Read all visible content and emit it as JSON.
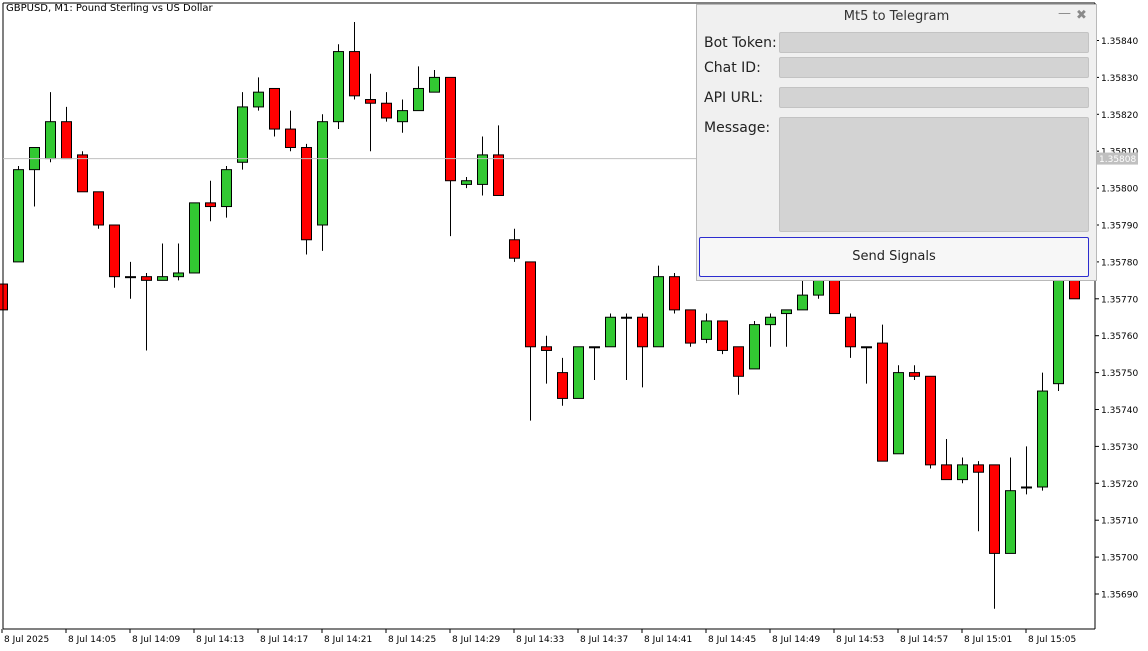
{
  "chart_header": {
    "symbol_text": "GBPUSD, M1:  Pound Sterling vs US Dollar"
  },
  "panel": {
    "title": "Mt5 to Telegram",
    "minimize_glyph": "—",
    "close_glyph": "✖",
    "bot_token_label": "Bot Token:",
    "chat_id_label": "Chat ID:",
    "api_url_label": "API URL:",
    "message_label": "Message:",
    "bot_token_value": "",
    "chat_id_value": "",
    "api_url_value": "",
    "message_value": "",
    "send_label": "Send Signals"
  },
  "colors": {
    "bull": "#32c832",
    "bear": "#ff0000",
    "panel_bg": "#f0f0f0",
    "field_bg": "#d3d3d3",
    "button_border": "#2c2ccf"
  },
  "chart_data": {
    "type": "candlestick",
    "symbol": "GBPUSD",
    "timeframe": "M1",
    "current_price": "1.35808",
    "y_ticks": [
      "1.35840",
      "1.35830",
      "1.35820",
      "1.35810",
      "1.35800",
      "1.35790",
      "1.35780",
      "1.35770",
      "1.35760",
      "1.35750",
      "1.35740",
      "1.35730",
      "1.35720",
      "1.35710",
      "1.35700",
      "1.35690"
    ],
    "x_ticks": [
      "8 Jul 2025",
      "8 Jul 14:05",
      "8 Jul 14:09",
      "8 Jul 14:13",
      "8 Jul 14:17",
      "8 Jul 14:21",
      "8 Jul 14:25",
      "8 Jul 14:29",
      "8 Jul 14:33",
      "8 Jul 14:37",
      "8 Jul 14:41",
      "8 Jul 14:45",
      "8 Jul 14:49",
      "8 Jul 14:53",
      "8 Jul 14:57",
      "8 Jul 15:01",
      "8 Jul 15:05"
    ],
    "candles": [
      {
        "o": 1.35774,
        "h": 1.35774,
        "l": 1.35767,
        "c": 1.35767
      },
      {
        "o": 1.3578,
        "h": 1.35806,
        "l": 1.3578,
        "c": 1.35805
      },
      {
        "o": 1.35805,
        "h": 1.35811,
        "l": 1.35795,
        "c": 1.35811
      },
      {
        "o": 1.35808,
        "h": 1.35826,
        "l": 1.35807,
        "c": 1.35818
      },
      {
        "o": 1.35818,
        "h": 1.35822,
        "l": 1.35808,
        "c": 1.35808
      },
      {
        "o": 1.35809,
        "h": 1.3581,
        "l": 1.35799,
        "c": 1.35799
      },
      {
        "o": 1.35799,
        "h": 1.35799,
        "l": 1.35789,
        "c": 1.3579
      },
      {
        "o": 1.3579,
        "h": 1.3579,
        "l": 1.35773,
        "c": 1.35776
      },
      {
        "o": 1.35776,
        "h": 1.3578,
        "l": 1.3577,
        "c": 1.35776
      },
      {
        "o": 1.35776,
        "h": 1.35777,
        "l": 1.35756,
        "c": 1.35775
      },
      {
        "o": 1.35775,
        "h": 1.35785,
        "l": 1.35775,
        "c": 1.35776
      },
      {
        "o": 1.35776,
        "h": 1.35785,
        "l": 1.35775,
        "c": 1.35777
      },
      {
        "o": 1.35777,
        "h": 1.35796,
        "l": 1.35777,
        "c": 1.35796
      },
      {
        "o": 1.35796,
        "h": 1.35802,
        "l": 1.35791,
        "c": 1.35795
      },
      {
        "o": 1.35795,
        "h": 1.35806,
        "l": 1.35792,
        "c": 1.35805
      },
      {
        "o": 1.35807,
        "h": 1.35826,
        "l": 1.35805,
        "c": 1.35822
      },
      {
        "o": 1.35822,
        "h": 1.3583,
        "l": 1.35821,
        "c": 1.35826
      },
      {
        "o": 1.35827,
        "h": 1.35827,
        "l": 1.35814,
        "c": 1.35816
      },
      {
        "o": 1.35816,
        "h": 1.35821,
        "l": 1.3581,
        "c": 1.35811
      },
      {
        "o": 1.35811,
        "h": 1.35812,
        "l": 1.35782,
        "c": 1.35786
      },
      {
        "o": 1.3579,
        "h": 1.3582,
        "l": 1.35783,
        "c": 1.35818
      },
      {
        "o": 1.35818,
        "h": 1.35839,
        "l": 1.35816,
        "c": 1.35837
      },
      {
        "o": 1.35837,
        "h": 1.35845,
        "l": 1.35824,
        "c": 1.35825
      },
      {
        "o": 1.35824,
        "h": 1.35831,
        "l": 1.3581,
        "c": 1.35823
      },
      {
        "o": 1.35823,
        "h": 1.35826,
        "l": 1.35818,
        "c": 1.35819
      },
      {
        "o": 1.35818,
        "h": 1.35824,
        "l": 1.35815,
        "c": 1.35821
      },
      {
        "o": 1.35821,
        "h": 1.35833,
        "l": 1.35821,
        "c": 1.35827
      },
      {
        "o": 1.35826,
        "h": 1.35832,
        "l": 1.35826,
        "c": 1.3583
      },
      {
        "o": 1.3583,
        "h": 1.3583,
        "l": 1.35787,
        "c": 1.35802
      },
      {
        "o": 1.35801,
        "h": 1.35803,
        "l": 1.358,
        "c": 1.35802
      },
      {
        "o": 1.35801,
        "h": 1.35814,
        "l": 1.35798,
        "c": 1.35809
      },
      {
        "o": 1.35809,
        "h": 1.35817,
        "l": 1.35798,
        "c": 1.35798
      },
      {
        "o": 1.35786,
        "h": 1.35789,
        "l": 1.3578,
        "c": 1.35781
      },
      {
        "o": 1.3578,
        "h": 1.3578,
        "l": 1.35737,
        "c": 1.35757
      },
      {
        "o": 1.35757,
        "h": 1.3576,
        "l": 1.35747,
        "c": 1.35756
      },
      {
        "o": 1.3575,
        "h": 1.35754,
        "l": 1.35741,
        "c": 1.35743
      },
      {
        "o": 1.35743,
        "h": 1.35757,
        "l": 1.35743,
        "c": 1.35757
      },
      {
        "o": 1.35757,
        "h": 1.35757,
        "l": 1.35748,
        "c": 1.35757
      },
      {
        "o": 1.35757,
        "h": 1.35766,
        "l": 1.35757,
        "c": 1.35765
      },
      {
        "o": 1.35765,
        "h": 1.35766,
        "l": 1.35748,
        "c": 1.35765
      },
      {
        "o": 1.35765,
        "h": 1.35766,
        "l": 1.35746,
        "c": 1.35757
      },
      {
        "o": 1.35757,
        "h": 1.35779,
        "l": 1.35757,
        "c": 1.35776
      },
      {
        "o": 1.35776,
        "h": 1.35777,
        "l": 1.35766,
        "c": 1.35767
      },
      {
        "o": 1.35767,
        "h": 1.35767,
        "l": 1.35757,
        "c": 1.35758
      },
      {
        "o": 1.35759,
        "h": 1.35766,
        "l": 1.35758,
        "c": 1.35764
      },
      {
        "o": 1.35764,
        "h": 1.35764,
        "l": 1.35755,
        "c": 1.35756
      },
      {
        "o": 1.35757,
        "h": 1.35757,
        "l": 1.35744,
        "c": 1.35749
      },
      {
        "o": 1.35751,
        "h": 1.35764,
        "l": 1.35751,
        "c": 1.35763
      },
      {
        "o": 1.35763,
        "h": 1.35766,
        "l": 1.35757,
        "c": 1.35765
      },
      {
        "o": 1.35766,
        "h": 1.35767,
        "l": 1.35757,
        "c": 1.35767
      },
      {
        "o": 1.35767,
        "h": 1.35775,
        "l": 1.35767,
        "c": 1.35771
      },
      {
        "o": 1.35771,
        "h": 1.35776,
        "l": 1.3577,
        "c": 1.35776
      },
      {
        "o": 1.35776,
        "h": 1.35777,
        "l": 1.35766,
        "c": 1.35766
      },
      {
        "o": 1.35765,
        "h": 1.35766,
        "l": 1.35754,
        "c": 1.35757
      },
      {
        "o": 1.35757,
        "h": 1.35757,
        "l": 1.35747,
        "c": 1.35757
      },
      {
        "o": 1.35758,
        "h": 1.35763,
        "l": 1.35726,
        "c": 1.35726
      },
      {
        "o": 1.35728,
        "h": 1.35752,
        "l": 1.35728,
        "c": 1.3575
      },
      {
        "o": 1.3575,
        "h": 1.35752,
        "l": 1.35748,
        "c": 1.35749
      },
      {
        "o": 1.35749,
        "h": 1.35749,
        "l": 1.35724,
        "c": 1.35725
      },
      {
        "o": 1.35725,
        "h": 1.35732,
        "l": 1.35721,
        "c": 1.35721
      },
      {
        "o": 1.35721,
        "h": 1.35727,
        "l": 1.3572,
        "c": 1.35725
      },
      {
        "o": 1.35725,
        "h": 1.35726,
        "l": 1.35707,
        "c": 1.35723
      },
      {
        "o": 1.35725,
        "h": 1.35725,
        "l": 1.35686,
        "c": 1.35701
      },
      {
        "o": 1.35701,
        "h": 1.35727,
        "l": 1.35701,
        "c": 1.35718
      },
      {
        "o": 1.35719,
        "h": 1.3573,
        "l": 1.35717,
        "c": 1.35719
      },
      {
        "o": 1.35719,
        "h": 1.3575,
        "l": 1.35718,
        "c": 1.35745
      },
      {
        "o": 1.35747,
        "h": 1.35776,
        "l": 1.35745,
        "c": 1.35775
      },
      {
        "o": 1.35775,
        "h": 1.35776,
        "l": 1.3577,
        "c": 1.3577
      }
    ]
  }
}
